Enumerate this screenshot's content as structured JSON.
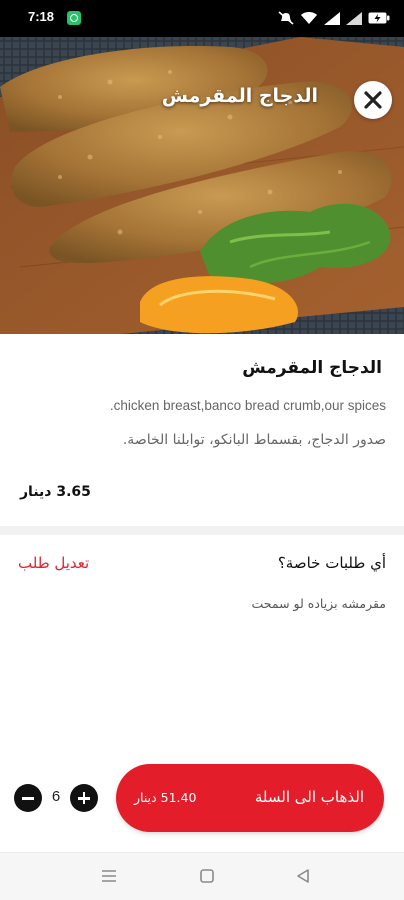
{
  "status_bar": {
    "time": "7:18",
    "icons": [
      "app-notification-icon",
      "mute-icon",
      "wifi-icon",
      "signal-icon",
      "signal-icon",
      "battery-icon"
    ]
  },
  "item": {
    "title": "الدجاج المقرمش",
    "description_en": ".chicken breast,banco bread crumb,our spices",
    "description_ar": "صدور الدجاج، بقسماط البانكو، توابلنا الخاصة.",
    "price": "3.65 دينار"
  },
  "special_requests": {
    "label": "أي طلبات خاصة؟",
    "edit_label": "تعديل طلب",
    "note": "مقرمشه بزياده لو سمحت"
  },
  "cart": {
    "quantity": "6",
    "button_label": "الذهاب الى السلة",
    "total": "51.40 دينار"
  },
  "colors": {
    "accent": "#e41d2b",
    "edit_link": "#e0242f",
    "status_bar": "#000000"
  }
}
